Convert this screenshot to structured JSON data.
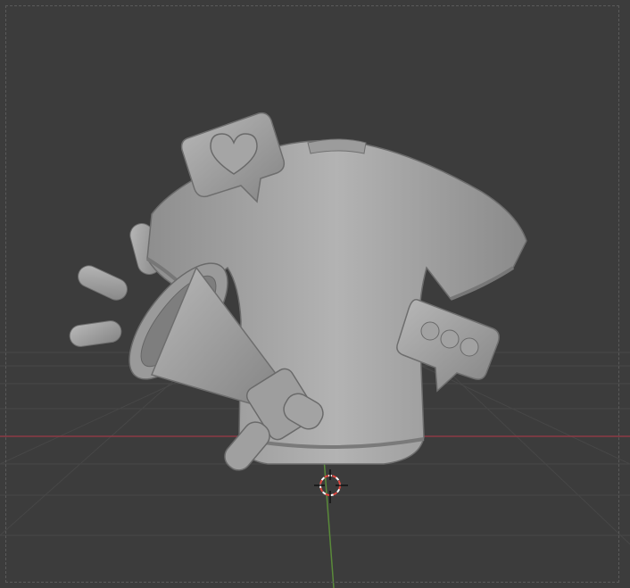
{
  "app": "3D Viewport",
  "scene": {
    "object": "t-shirt",
    "props": [
      "heart-speech-bubble",
      "megaphone",
      "typing-chat-bubble",
      "shout-lines"
    ]
  },
  "colors": {
    "background": "#3c3c3c",
    "grid_line": "#4a4a4a",
    "x_axis": "#8c3a45",
    "y_axis": "#5a8a3a",
    "model": "#a8a8a8",
    "cursor_red": "#e0473f"
  }
}
